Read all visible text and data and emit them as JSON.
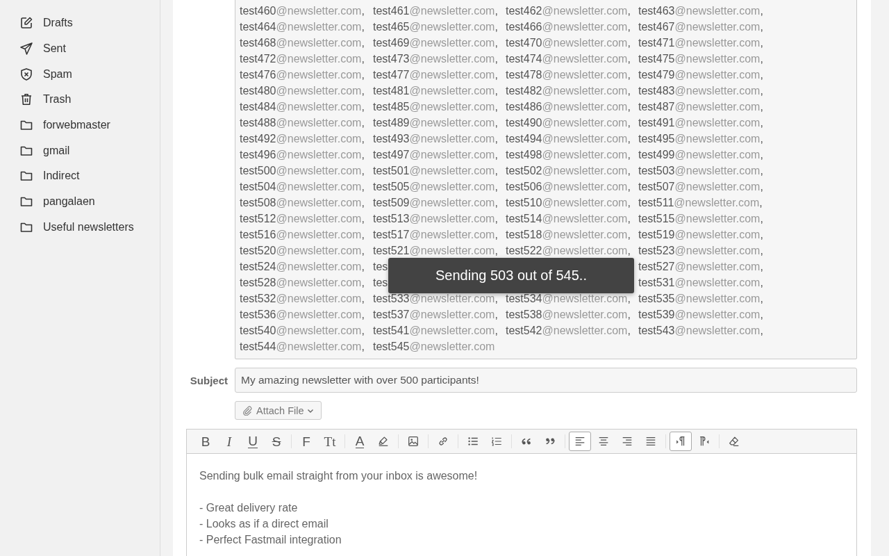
{
  "sidebar": {
    "items": [
      {
        "label": "Drafts",
        "kind": "drafts"
      },
      {
        "label": "Sent",
        "kind": "sent"
      },
      {
        "label": "Spam",
        "kind": "spam"
      },
      {
        "label": "Trash",
        "kind": "trash"
      },
      {
        "label": "forwebmaster",
        "kind": "folder"
      },
      {
        "label": "gmail",
        "kind": "folder"
      },
      {
        "label": "Indirect",
        "kind": "folder"
      },
      {
        "label": "pangalaen",
        "kind": "folder"
      },
      {
        "label": "Useful newsletters",
        "kind": "folder"
      }
    ]
  },
  "recipients": [
    {
      "user": "test460",
      "domain": "@newsletter.com",
      "sep": ","
    },
    {
      "user": "test461",
      "domain": "@newsletter.com",
      "sep": ","
    },
    {
      "user": "test462",
      "domain": "@newsletter.com",
      "sep": ","
    },
    {
      "user": "test463",
      "domain": "@newsletter.com",
      "sep": ","
    },
    {
      "user": "test464",
      "domain": "@newsletter.com",
      "sep": ","
    },
    {
      "user": "test465",
      "domain": "@newsletter.com",
      "sep": ","
    },
    {
      "user": "test466",
      "domain": "@newsletter.com",
      "sep": ","
    },
    {
      "user": "test467",
      "domain": "@newsletter.com",
      "sep": ","
    },
    {
      "user": "test468",
      "domain": "@newsletter.com",
      "sep": ","
    },
    {
      "user": "test469",
      "domain": "@newsletter.com",
      "sep": ","
    },
    {
      "user": "test470",
      "domain": "@newsletter.com",
      "sep": ","
    },
    {
      "user": "test471",
      "domain": "@newsletter.com",
      "sep": ","
    },
    {
      "user": "test472",
      "domain": "@newsletter.com",
      "sep": ","
    },
    {
      "user": "test473",
      "domain": "@newsletter.com",
      "sep": ","
    },
    {
      "user": "test474",
      "domain": "@newsletter.com",
      "sep": ","
    },
    {
      "user": "test475",
      "domain": "@newsletter.com",
      "sep": ","
    },
    {
      "user": "test476",
      "domain": "@newsletter.com",
      "sep": ","
    },
    {
      "user": "test477",
      "domain": "@newsletter.com",
      "sep": ","
    },
    {
      "user": "test478",
      "domain": "@newsletter.com",
      "sep": ","
    },
    {
      "user": "test479",
      "domain": "@newsletter.com",
      "sep": ","
    },
    {
      "user": "test480",
      "domain": "@newsletter.com",
      "sep": ","
    },
    {
      "user": "test481",
      "domain": "@newsletter.com",
      "sep": ","
    },
    {
      "user": "test482",
      "domain": "@newsletter.com",
      "sep": ","
    },
    {
      "user": "test483",
      "domain": "@newsletter.com",
      "sep": ","
    },
    {
      "user": "test484",
      "domain": "@newsletter.com",
      "sep": ","
    },
    {
      "user": "test485",
      "domain": "@newsletter.com",
      "sep": ","
    },
    {
      "user": "test486",
      "domain": "@newsletter.com",
      "sep": ","
    },
    {
      "user": "test487",
      "domain": "@newsletter.com",
      "sep": ","
    },
    {
      "user": "test488",
      "domain": "@newsletter.com",
      "sep": ","
    },
    {
      "user": "test489",
      "domain": "@newsletter.com",
      "sep": ","
    },
    {
      "user": "test490",
      "domain": "@newsletter.com",
      "sep": ","
    },
    {
      "user": "test491",
      "domain": "@newsletter.com",
      "sep": ","
    },
    {
      "user": "test492",
      "domain": "@newsletter.com",
      "sep": ","
    },
    {
      "user": "test493",
      "domain": "@newsletter.com",
      "sep": ","
    },
    {
      "user": "test494",
      "domain": "@newsletter.com",
      "sep": ","
    },
    {
      "user": "test495",
      "domain": "@newsletter.com",
      "sep": ","
    },
    {
      "user": "test496",
      "domain": "@newsletter.com",
      "sep": ","
    },
    {
      "user": "test497",
      "domain": "@newsletter.com",
      "sep": ","
    },
    {
      "user": "test498",
      "domain": "@newsletter.com",
      "sep": ","
    },
    {
      "user": "test499",
      "domain": "@newsletter.com",
      "sep": ","
    },
    {
      "user": "test500",
      "domain": "@newsletter.com",
      "sep": ","
    },
    {
      "user": "test501",
      "domain": "@newsletter.com",
      "sep": ","
    },
    {
      "user": "test502",
      "domain": "@newsletter.com",
      "sep": ","
    },
    {
      "user": "test503",
      "domain": "@newsletter.com",
      "sep": ","
    },
    {
      "user": "test504",
      "domain": "@newsletter.com",
      "sep": ","
    },
    {
      "user": "test505",
      "domain": "@newsletter.com",
      "sep": ","
    },
    {
      "user": "test506",
      "domain": "@newsletter.com",
      "sep": ","
    },
    {
      "user": "test507",
      "domain": "@newsletter.com",
      "sep": ","
    },
    {
      "user": "test508",
      "domain": "@newsletter.com",
      "sep": ","
    },
    {
      "user": "test509",
      "domain": "@newsletter.com",
      "sep": ","
    },
    {
      "user": "test510",
      "domain": "@newsletter.com",
      "sep": ","
    },
    {
      "user": "test511",
      "domain": "@newsletter.com",
      "sep": ","
    },
    {
      "user": "test512",
      "domain": "@newsletter.com",
      "sep": ","
    },
    {
      "user": "test513",
      "domain": "@newsletter.com",
      "sep": ","
    },
    {
      "user": "test514",
      "domain": "@newsletter.com",
      "sep": ","
    },
    {
      "user": "test515",
      "domain": "@newsletter.com",
      "sep": ","
    },
    {
      "user": "test516",
      "domain": "@newsletter.com",
      "sep": ","
    },
    {
      "user": "test517",
      "domain": "@newsletter.com",
      "sep": ","
    },
    {
      "user": "test518",
      "domain": "@newsletter.com",
      "sep": ","
    },
    {
      "user": "test519",
      "domain": "@newsletter.com",
      "sep": ","
    },
    {
      "user": "test520",
      "domain": "@newsletter.com",
      "sep": ","
    },
    {
      "user": "test521",
      "domain": "@newsletter.com",
      "sep": ","
    },
    {
      "user": "test522",
      "domain": "@newsletter.com",
      "sep": ","
    },
    {
      "user": "test523",
      "domain": "@newsletter.com",
      "sep": ","
    },
    {
      "user": "test524",
      "domain": "@newsletter.com",
      "sep": ","
    },
    {
      "user": "tes"
    },
    {
      "user": "test527",
      "domain": "@newsletter.com",
      "sep": ","
    },
    {
      "user": "test528",
      "domain": "@newsletter.com",
      "sep": ","
    },
    {
      "user": "tes"
    },
    {
      "user": "test531",
      "domain": "@newsletter.com",
      "sep": ","
    },
    {
      "user": "test532",
      "domain": "@newsletter.com",
      "sep": ","
    },
    {
      "user": "test533",
      "domain": "@newsletter.com",
      "sep": ","
    },
    {
      "user": "test534",
      "domain": "@newsletter.com",
      "sep": ","
    },
    {
      "user": "test535",
      "domain": "@newsletter.com",
      "sep": ","
    },
    {
      "user": "test536",
      "domain": "@newsletter.com",
      "sep": ","
    },
    {
      "user": "test537",
      "domain": "@newsletter.com",
      "sep": ","
    },
    {
      "user": "test538",
      "domain": "@newsletter.com",
      "sep": ","
    },
    {
      "user": "test539",
      "domain": "@newsletter.com",
      "sep": ","
    },
    {
      "user": "test540",
      "domain": "@newsletter.com",
      "sep": ","
    },
    {
      "user": "test541",
      "domain": "@newsletter.com",
      "sep": ","
    },
    {
      "user": "test542",
      "domain": "@newsletter.com",
      "sep": ","
    },
    {
      "user": "test543",
      "domain": "@newsletter.com",
      "sep": ","
    },
    {
      "user": "test544",
      "domain": "@newsletter.com",
      "sep": ","
    },
    {
      "user": "test545",
      "domain": "@newsletter.com"
    }
  ],
  "subject": {
    "label": "Subject",
    "value": "My amazing newsletter with over 500 participants!"
  },
  "attach_button": {
    "label": "Attach File"
  },
  "toolbar": [
    [
      {
        "kind": "bold",
        "label": "B",
        "selected": false
      },
      {
        "kind": "italic",
        "label": "I",
        "selected": false
      },
      {
        "kind": "underline",
        "label": "U",
        "selected": false
      },
      {
        "kind": "strike",
        "label": "S",
        "selected": false
      }
    ],
    [
      {
        "kind": "font",
        "label": "F",
        "selected": false
      },
      {
        "kind": "size",
        "label": "Tt",
        "selected": false
      }
    ],
    [
      {
        "kind": "color",
        "label": "A",
        "selected": false
      },
      {
        "kind": "highlight",
        "selected": false
      }
    ],
    [
      {
        "kind": "image",
        "selected": false
      }
    ],
    [
      {
        "kind": "link",
        "selected": false
      }
    ],
    [
      {
        "kind": "bullets",
        "selected": false
      },
      {
        "kind": "numbers",
        "selected": false
      }
    ],
    [
      {
        "kind": "quote-open",
        "selected": false
      },
      {
        "kind": "quote-close",
        "selected": false
      }
    ],
    [
      {
        "kind": "align-left",
        "selected": true
      },
      {
        "kind": "align-center",
        "selected": false
      },
      {
        "kind": "align-right",
        "selected": false
      },
      {
        "kind": "justify",
        "selected": false
      }
    ],
    [
      {
        "kind": "ltr",
        "selected": true
      },
      {
        "kind": "rtl",
        "selected": false
      }
    ],
    [
      {
        "kind": "eraser",
        "selected": false
      }
    ]
  ],
  "body": {
    "paragraphs": [
      [
        "Sending bulk email straight from your inbox is awesome!"
      ],
      [
        "- Great delivery rate",
        "- Looks as if a direct email",
        "- Perfect Fastmail integration"
      ]
    ]
  },
  "toast": {
    "text": "Sending 503 out of 545.."
  }
}
